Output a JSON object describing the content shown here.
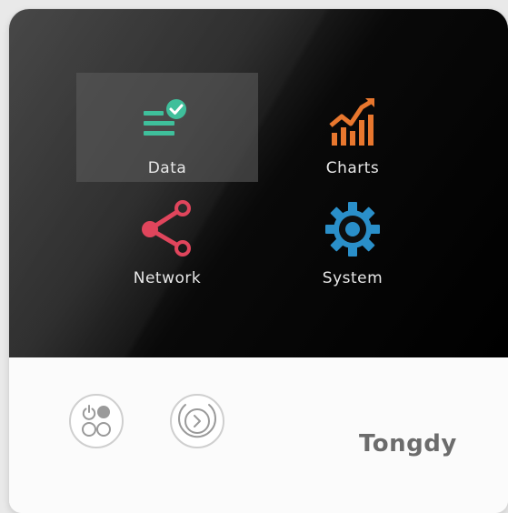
{
  "menu": {
    "items": [
      {
        "label": "Data",
        "icon": "data-check-icon",
        "color": "#3fbf9b",
        "selected": true
      },
      {
        "label": "Charts",
        "icon": "bar-chart-icon",
        "color": "#e8772e",
        "selected": false
      },
      {
        "label": "Network",
        "icon": "share-network-icon",
        "color": "#e0455c",
        "selected": false
      },
      {
        "label": "System",
        "icon": "gear-icon",
        "color": "#2a8fc9",
        "selected": false
      }
    ]
  },
  "hardware": {
    "power_button_icon": "power-icon",
    "next_button_icon": "chevron-right-icon"
  },
  "brand": {
    "logo_text": "Tongdy"
  }
}
